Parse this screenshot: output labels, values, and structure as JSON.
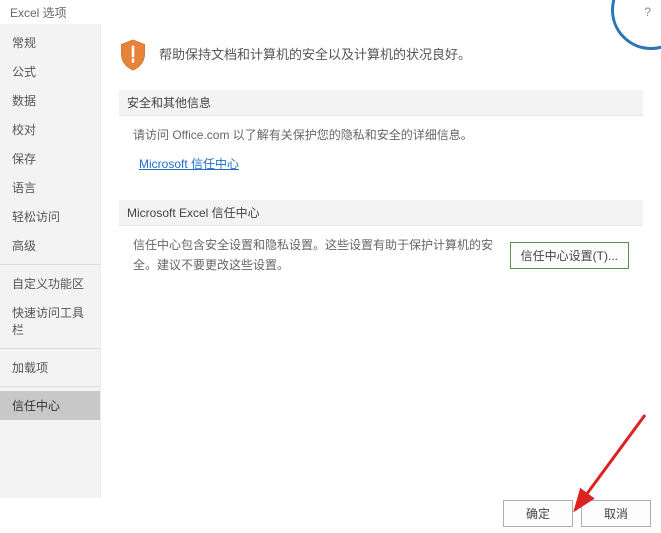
{
  "titlebar": {
    "title": "Excel 选项",
    "help": "?"
  },
  "sidebar": {
    "items": [
      "常规",
      "公式",
      "数据",
      "校对",
      "保存",
      "语言",
      "轻松访问",
      "高级"
    ],
    "items2": [
      "自定义功能区",
      "快速访问工具栏"
    ],
    "items3": [
      "加载项"
    ],
    "active": "信任中心"
  },
  "hero": {
    "text": "帮助保持文档和计算机的安全以及计算机的状况良好。"
  },
  "section1": {
    "header": "安全和其他信息",
    "desc": "请访问 Office.com  以了解有关保护您的隐私和安全的详细信息。",
    "link": "Microsoft 信任中心"
  },
  "section2": {
    "header": "Microsoft Excel 信任中心",
    "desc": "信任中心包含安全设置和隐私设置。这些设置有助于保护计算机的安全。建议不要更改这些设置。",
    "button": "信任中心设置(T)..."
  },
  "footer": {
    "ok": "确定",
    "cancel": "取消"
  }
}
